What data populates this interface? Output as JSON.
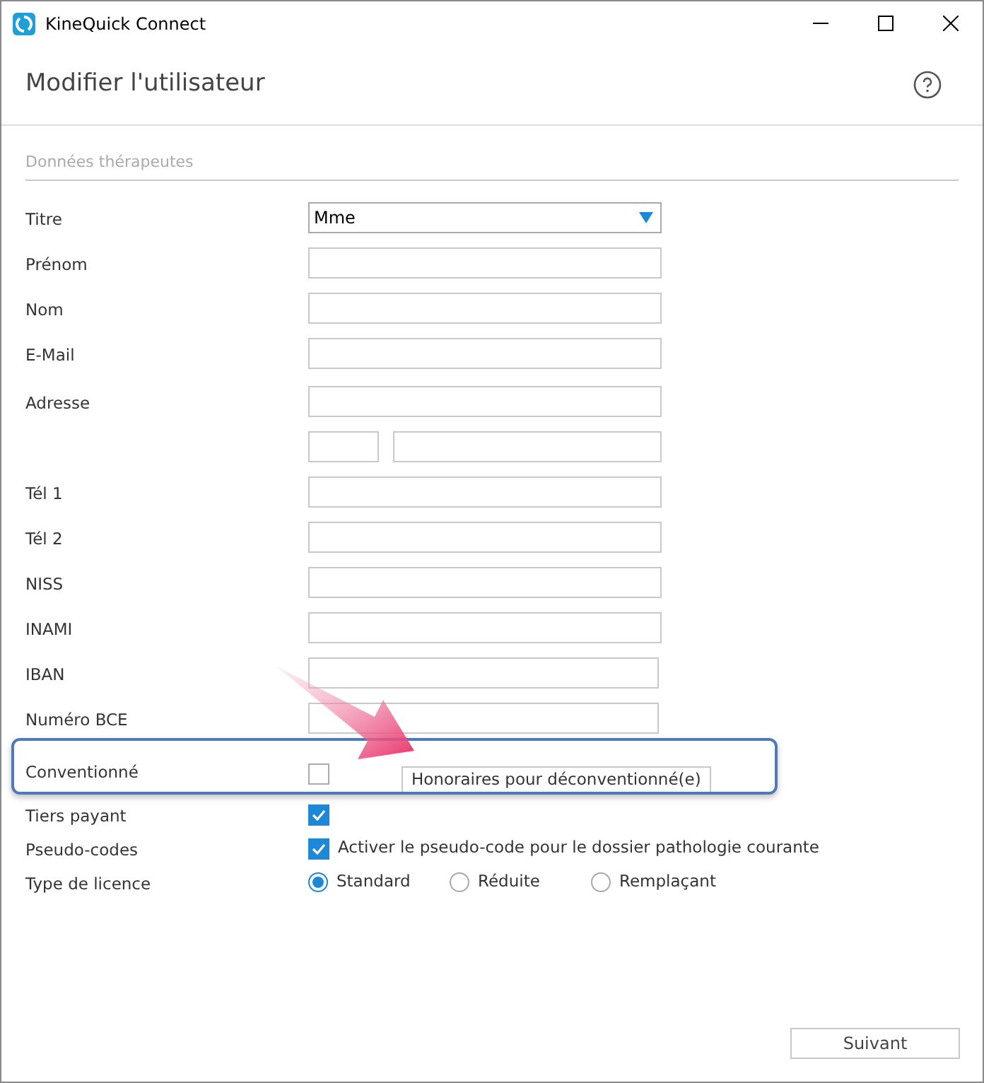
{
  "window": {
    "title": "KineQuick Connect"
  },
  "heading": "Modifier l'utilisateur",
  "section": "Données thérapeutes",
  "rows": [
    {
      "kind": "select",
      "label": "Titre",
      "value": "Mme"
    },
    {
      "kind": "text",
      "label": "Prénom"
    },
    {
      "kind": "text",
      "label": "Nom"
    },
    {
      "kind": "text",
      "label": "E-Mail"
    },
    {
      "kind": "text",
      "label": "Adresse"
    },
    {
      "kind": "split"
    },
    {
      "kind": "text",
      "label": "Tél 1"
    },
    {
      "kind": "text",
      "label": "Tél 2"
    },
    {
      "kind": "text",
      "label": "NISS"
    },
    {
      "kind": "text",
      "label": "INAMI"
    },
    {
      "kind": "text",
      "label": "IBAN"
    },
    {
      "kind": "text",
      "label": "Numéro BCE"
    },
    {
      "kind": "checkbox_button",
      "label": "Conventionné",
      "checked": false,
      "button": "Honoraires pour déconventionné(e)",
      "highlighted": true
    },
    {
      "kind": "checkbox",
      "label": "Tiers payant",
      "checked": true
    },
    {
      "kind": "checkbox",
      "label": "Pseudo-codes",
      "checked": true,
      "text": "Activer le pseudo-code pour le dossier pathologie courante"
    },
    {
      "kind": "radio",
      "label": "Type de licence",
      "options": [
        {
          "label": "Standard",
          "selected": true
        },
        {
          "label": "Réduite",
          "selected": false
        },
        {
          "label": "Remplaçant",
          "selected": false
        }
      ]
    }
  ],
  "footer": {
    "button": "Suivant"
  }
}
